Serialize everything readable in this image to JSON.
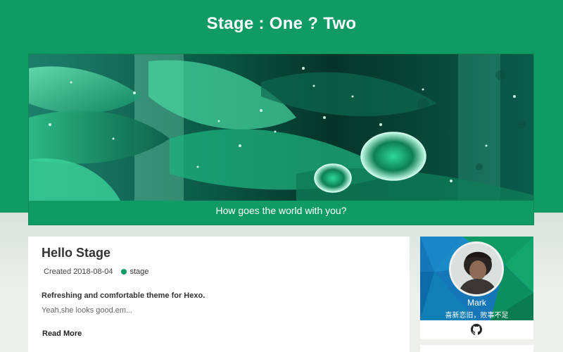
{
  "header": {
    "site_title": "Stage : One ? Two",
    "banner_caption": "How goes the world with you?"
  },
  "post": {
    "title": "Hello Stage",
    "created": "Created 2018-08-04",
    "tag": "stage",
    "summary_bold": "Refreshing and comfortable theme for Hexo.",
    "summary": "Yeah,she looks good.em...",
    "read_more": "Read More"
  },
  "profile": {
    "name": "Mark",
    "motto": "喜新恋旧，败事不足",
    "link_icon": "github-icon"
  },
  "colors": {
    "accent": "#0f9b63",
    "background": "#e6ebe6"
  }
}
